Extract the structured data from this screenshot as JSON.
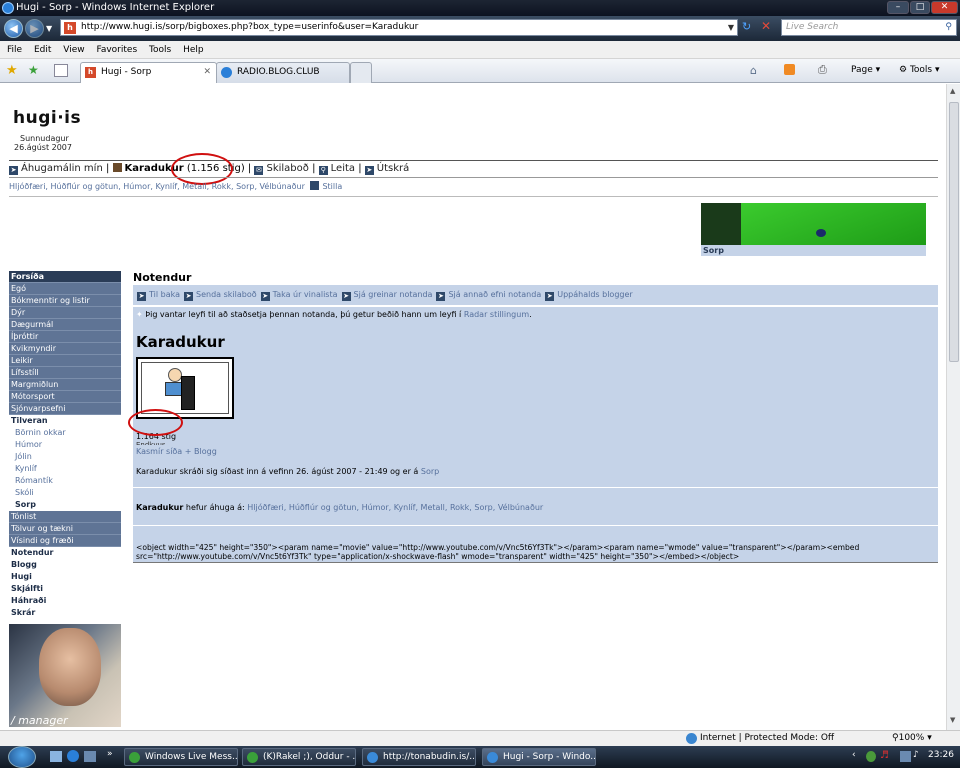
{
  "window": {
    "title": "Hugi - Sorp - Windows Internet Explorer"
  },
  "address": {
    "url": "http://www.hugi.is/sorp/bigboxes.php?box_type=userinfo&user=Karadukur",
    "search_placeholder": "Live Search"
  },
  "menu": [
    "File",
    "Edit",
    "View",
    "Favorites",
    "Tools",
    "Help"
  ],
  "tabs": [
    {
      "label": "Hugi - Sorp",
      "active": true
    },
    {
      "label": "RADIO.BLOG.CLUB",
      "active": false
    }
  ],
  "toolbar": {
    "page_label": "Page",
    "tools_label": "Tools"
  },
  "site": {
    "logo": "hugi·is",
    "day": "Sunnudagur",
    "date": "26.ágúst 2007",
    "nav": {
      "interests": "Áhugamálin mín",
      "user": "Karadukur",
      "points": "(1.156 stig)",
      "messages": "Skilaboð",
      "search": "Leita",
      "logout": "Útskrá"
    },
    "interests": "Hljóðfæri, Húðflúr og götun, Húmor, Kynlíf, Metall, Rokk, Sorp, Vélbúnaður",
    "settings": "Stilla",
    "banner_caption": "Sorp"
  },
  "sidebar": [
    {
      "label": "Forsíða",
      "style": "first"
    },
    {
      "label": "Egó",
      "style": "dark"
    },
    {
      "label": "Bókmenntir og listir",
      "style": "dark"
    },
    {
      "label": "Dýr",
      "style": "dark"
    },
    {
      "label": "Dægurmál",
      "style": "dark"
    },
    {
      "label": "Íþróttir",
      "style": "dark"
    },
    {
      "label": "Kvikmyndir",
      "style": "dark"
    },
    {
      "label": "Leikir",
      "style": "dark"
    },
    {
      "label": "Lífsstíll",
      "style": "dark"
    },
    {
      "label": "Margmiðlun",
      "style": "dark"
    },
    {
      "label": "Mótorsport",
      "style": "dark"
    },
    {
      "label": "Sjónvarpsefni",
      "style": "dark"
    },
    {
      "label": "Tilveran",
      "style": "sec"
    },
    {
      "label": "Börnin okkar",
      "style": "sub"
    },
    {
      "label": "Húmor",
      "style": "sub"
    },
    {
      "label": "Jólin",
      "style": "sub"
    },
    {
      "label": "Kynlíf",
      "style": "sub"
    },
    {
      "label": "Rómantík",
      "style": "sub"
    },
    {
      "label": "Skóli",
      "style": "sub"
    },
    {
      "label": "Sorp",
      "style": "subsel"
    },
    {
      "label": "Tónlist",
      "style": "dark"
    },
    {
      "label": "Tölvur og tækni",
      "style": "dark"
    },
    {
      "label": "Vísindi og fræði",
      "style": "dark"
    },
    {
      "label": "Notendur",
      "style": "sec"
    },
    {
      "label": "Blogg",
      "style": "sec"
    },
    {
      "label": "Hugi",
      "style": "sec"
    },
    {
      "label": "Skjálfti",
      "style": "sec"
    },
    {
      "label": "Háhraði",
      "style": "sec"
    },
    {
      "label": "Skrár",
      "style": "sec"
    }
  ],
  "sidebar_photo_caption": "/ manager",
  "main": {
    "section_title": "Notendur",
    "actions": [
      "Til baka",
      "Senda skilaboð",
      "Taka úr vinalista",
      "Sjá greinar notanda",
      "Sjá annað efni notanda",
      "Uppáhalds blogger"
    ],
    "notice_pre": "Þig vantar leyfi til að staðsetja þennan notanda, þú getur beðið hann um leyfi í",
    "notice_link": "Radar stillingum",
    "notice_end": ".",
    "username": "Karadukur",
    "points": "1.164 stig",
    "points_behind": "Endkvus",
    "kasmir": "Kasmír síða",
    "blogg": "+ Blogg",
    "last_login_text": "Karadukur skráði sig síðast inn á vefinn 26. ágúst 2007 - 21:49 og er á",
    "last_login_link": "Sorp",
    "interest_user": "Karadukur",
    "interest_label": "hefur áhuga á:",
    "interest_values": "Hljóðfæri, Húðflúr og götun, Húmor, Kynlíf, Metall, Rokk, Sorp, Vélbúnaður",
    "embed_line1": "<object width=\"425\" height=\"350\"><param name=\"movie\" value=\"http://www.youtube.com/v/Vnc5t6Yf3Tk\"></param><param name=\"wmode\" value=\"transparent\"></param><embed",
    "embed_line2": "src=\"http://www.youtube.com/v/Vnc5t6Yf3Tk\" type=\"application/x-shockwave-flash\" wmode=\"transparent\" width=\"425\" height=\"350\"></embed></object>"
  },
  "status": {
    "zone": "Internet | Protected Mode: Off",
    "zoom": "100%"
  },
  "taskbar": {
    "items": [
      "Windows Live Mess...",
      "(K)Rakel ;), Oddur - ...",
      "http://tonabudin.is/...",
      "Hugi - Sorp - Windo..."
    ],
    "clock": "23:26"
  },
  "colors": {
    "page_accent": "#c5d3e8",
    "sidebar": "#5f7495",
    "link": "#56709c",
    "annotation": "#d01010"
  }
}
